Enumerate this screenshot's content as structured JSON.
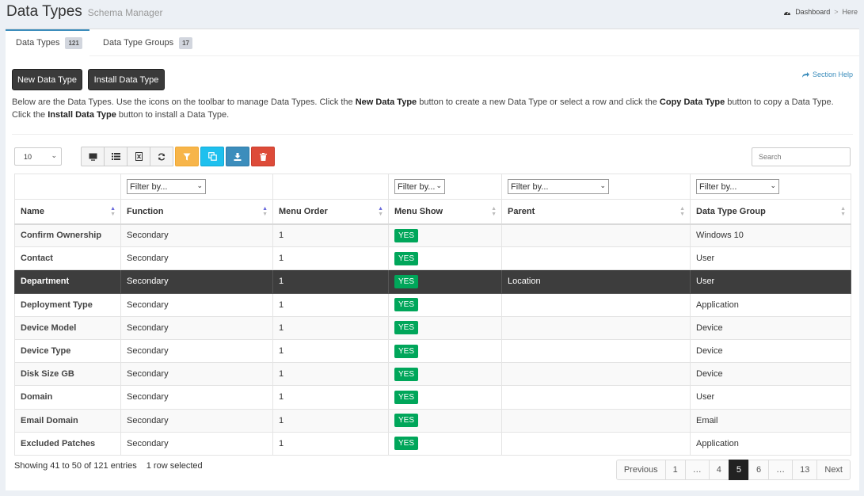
{
  "header": {
    "title": "Data Types",
    "subtitle": "Schema Manager"
  },
  "breadcrumb": {
    "dashboard": "Dashboard",
    "separator": ">",
    "here": "Here"
  },
  "tabs": [
    {
      "label": "Data Types",
      "count": "121"
    },
    {
      "label": "Data Type Groups",
      "count": "17"
    }
  ],
  "buttons": {
    "new": "New Data Type",
    "install": "Install Data Type",
    "section_help": "Section Help"
  },
  "description": {
    "t1": "Below are the Data Types. Use the icons on the toolbar to manage Data Types. Click the ",
    "b1": "New Data Type",
    "t2": " button to create a new Data Type or select a row and click the ",
    "b2": "Copy Data Type",
    "t3": " button to copy a Data Type. Click the ",
    "b3": "Install Data Type",
    "t4": " button to install a Data Type."
  },
  "page_size": "10",
  "search": {
    "placeholder": "Search"
  },
  "filters": [
    "Filter by...",
    "Filter by...",
    "Filter by...",
    "Filter by..."
  ],
  "columns": [
    "Name",
    "Function",
    "Menu Order",
    "Menu Show",
    "Parent",
    "Data Type Group"
  ],
  "rows": [
    {
      "name": "Confirm Ownership",
      "function": "Secondary",
      "order": "1",
      "show": "YES",
      "parent": "",
      "group": "Windows 10"
    },
    {
      "name": "Contact",
      "function": "Secondary",
      "order": "1",
      "show": "YES",
      "parent": "",
      "group": "User"
    },
    {
      "name": "Department",
      "function": "Secondary",
      "order": "1",
      "show": "YES",
      "parent": "Location",
      "group": "User"
    },
    {
      "name": "Deployment Type",
      "function": "Secondary",
      "order": "1",
      "show": "YES",
      "parent": "",
      "group": "Application"
    },
    {
      "name": "Device Model",
      "function": "Secondary",
      "order": "1",
      "show": "YES",
      "parent": "",
      "group": "Device"
    },
    {
      "name": "Device Type",
      "function": "Secondary",
      "order": "1",
      "show": "YES",
      "parent": "",
      "group": "Device"
    },
    {
      "name": "Disk Size GB",
      "function": "Secondary",
      "order": "1",
      "show": "YES",
      "parent": "",
      "group": "Device"
    },
    {
      "name": "Domain",
      "function": "Secondary",
      "order": "1",
      "show": "YES",
      "parent": "",
      "group": "User"
    },
    {
      "name": "Email Domain",
      "function": "Secondary",
      "order": "1",
      "show": "YES",
      "parent": "",
      "group": "Email"
    },
    {
      "name": "Excluded Patches",
      "function": "Secondary",
      "order": "1",
      "show": "YES",
      "parent": "",
      "group": "Application"
    }
  ],
  "footer": {
    "showing": "Showing 41 to 50 of 121 entries",
    "selected": "1 row selected"
  },
  "pagination": [
    "Previous",
    "1",
    "…",
    "4",
    "5",
    "6",
    "…",
    "13",
    "Next"
  ],
  "colors": {
    "accent": "#3c8dbc",
    "yes_badge": "#00a65a",
    "selected_row": "#3d3d3d"
  }
}
